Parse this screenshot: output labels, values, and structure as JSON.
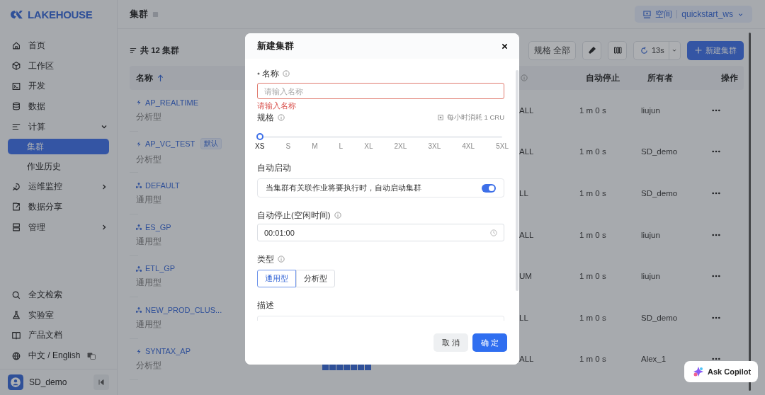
{
  "brand": {
    "name": "LAKEHOUSE"
  },
  "nav": [
    {
      "label": "首页",
      "selected": false
    },
    {
      "label": "工作区",
      "selected": false
    },
    {
      "label": "开发",
      "selected": false
    },
    {
      "label": "数据",
      "selected": false
    },
    {
      "label": "计算",
      "selected": false,
      "expanded": true,
      "children": [
        {
          "label": "集群",
          "selected": true
        },
        {
          "label": "作业历史",
          "selected": false
        }
      ]
    },
    {
      "label": "运维监控",
      "selected": false,
      "expanded": false
    },
    {
      "label": "数据分享",
      "selected": false
    },
    {
      "label": "管理",
      "selected": false,
      "expanded": false
    }
  ],
  "bottom_nav": [
    {
      "label": "全文检索"
    },
    {
      "label": "实验室"
    },
    {
      "label": "产品文档"
    },
    {
      "label": "中文 / English"
    }
  ],
  "user": {
    "name": "SD_demo"
  },
  "header": {
    "title": "集群",
    "workspace_label": "空间",
    "workspace": "quickstart_ws"
  },
  "toolbar": {
    "count": "共 12 集群",
    "spec_filter": "规格 全部",
    "refresh": "13s",
    "create": "新建集群"
  },
  "table": {
    "columns": [
      {
        "kind": "text",
        "label": "名称",
        "sorted_ascending": true
      },
      {
        "kind": "blank"
      },
      {
        "kind": "info"
      },
      {
        "kind": "text",
        "label": "自动停止"
      },
      {
        "kind": "text",
        "label": "所有者"
      },
      {
        "kind": "text",
        "label": "操作"
      }
    ],
    "rows": [
      {
        "name": "AP_REALTIME",
        "kind": "analytic",
        "type": "分析型",
        "spec": "ALL",
        "auto_stop": "1 m 0 s",
        "owner": "liujun"
      },
      {
        "name": "AP_VC_TEST",
        "kind": "analytic",
        "badge": "默认",
        "type": "分析型",
        "spec": "ALL",
        "auto_stop": "1 m 0 s",
        "owner": "SD_demo"
      },
      {
        "name": "DEFAULT",
        "kind": "general",
        "type": "通用型",
        "spec": "LL",
        "auto_stop": "1 m 0 s",
        "owner": "SD_demo"
      },
      {
        "name": "ES_GP",
        "kind": "general",
        "type": "通用型",
        "spec": "ALL",
        "auto_stop": "1 m 0 s",
        "owner": "liujun"
      },
      {
        "name": "ETL_GP",
        "kind": "general",
        "type": "通用型",
        "spec": "UM",
        "auto_stop": "1 m 0 s",
        "owner": "liujun"
      },
      {
        "name": "NEW_PROD_CLUS...",
        "kind": "general",
        "type": "通用型",
        "spec": "LL",
        "auto_stop": "1 m 0 s",
        "owner": "SD_demo"
      },
      {
        "name": "SYNTAX_AP",
        "kind": "analytic",
        "type": "分析型",
        "spec": "ALL",
        "auto_stop": "1 m 0 s",
        "owner": "Alex_1",
        "usage_bar": true
      }
    ]
  },
  "dialog": {
    "title": "新建集群",
    "name_field": {
      "label": "名称",
      "required": true,
      "placeholder": "请输入名称",
      "error": "请输入名称"
    },
    "size_field": {
      "label": "规格",
      "cost": "每小时消耗 1 CRU",
      "level": 0,
      "marks": [
        "XS",
        "S",
        "M",
        "L",
        "XL",
        "2XL",
        "3XL",
        "4XL",
        "5XL"
      ]
    },
    "auto_start": {
      "label": "自动启动",
      "description": "当集群有关联作业将要执行时，自动启动集群",
      "on": true
    },
    "auto_stop": {
      "label": "自动停止(空闲时间)",
      "value": "00:01:00"
    },
    "type_field": {
      "label": "类型",
      "options": [
        {
          "label": "通用型",
          "selected": true
        },
        {
          "label": "分析型",
          "selected": false
        }
      ]
    },
    "description_field": {
      "label": "描述"
    },
    "buttons": [
      {
        "label": "取 消",
        "kind": "secondary"
      },
      {
        "label": "确 定",
        "kind": "primary"
      }
    ]
  },
  "copilot": {
    "label": "Ask Copilot"
  }
}
